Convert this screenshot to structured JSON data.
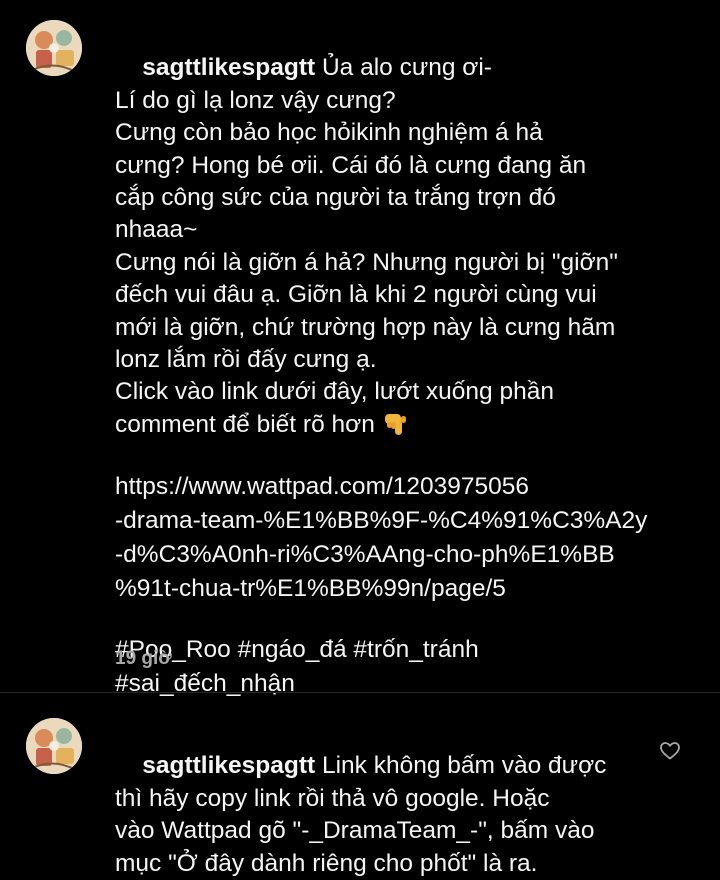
{
  "comments": [
    {
      "username": "sagttlikespagtt",
      "text_lines": [
        "Ủa alo cưng ơi-",
        "Lí do gì lạ lonz vậy cưng?",
        "Cưng còn bảo học hỏikinh nghiệm á hả",
        "cưng? Hong bé ơii. Cái đó là cưng đang ăn",
        "cắp công sức của người ta trắng trợn đó",
        "nhaaa~",
        "Cưng nói là giỡn á hả? Nhưng người bị \"giỡn\"",
        "đếch vui đâu ạ. Giỡn là khi 2 người cùng vui",
        "mới là giỡn, chứ trường hợp này là cưng hãm",
        "lonz lắm rồi đấy cưng ạ.",
        "Click vào link dưới đây, lướt xuống phần",
        "comment để biết rõ hơn"
      ],
      "emoji": "backhand-index-pointing-down",
      "link_lines": [
        "https://www.wattpad.com/1203975056",
        "-drama-team-%E1%BB%9F-%C4%91%C3%A2y",
        "-d%C3%A0nh-ri%C3%AAng-cho-ph%E1%BB",
        "%91t-chua-tr%E1%BB%99n/page/5"
      ],
      "hashtag_lines": [
        "#Poo_Roo #ngáo_đá #trốn_tránh",
        "#sai_đếch_nhận"
      ],
      "time": "19 giờ"
    },
    {
      "username": "sagttlikespagtt",
      "text_lines": [
        "Link không bấm vào được",
        "thì hãy copy link rồi thả vô google. Hoặc",
        "vào Wattpad gõ \"-_DramaTeam_-\", bấm vào",
        "mục \"Ở đây dành riêng cho phốt\" là ra."
      ],
      "like_icon": "heart-outline-icon"
    }
  ],
  "colors": {
    "background": "#000000",
    "text": "#f5f5f5",
    "secondary": "#a8a8a8",
    "divider": "#262626"
  }
}
